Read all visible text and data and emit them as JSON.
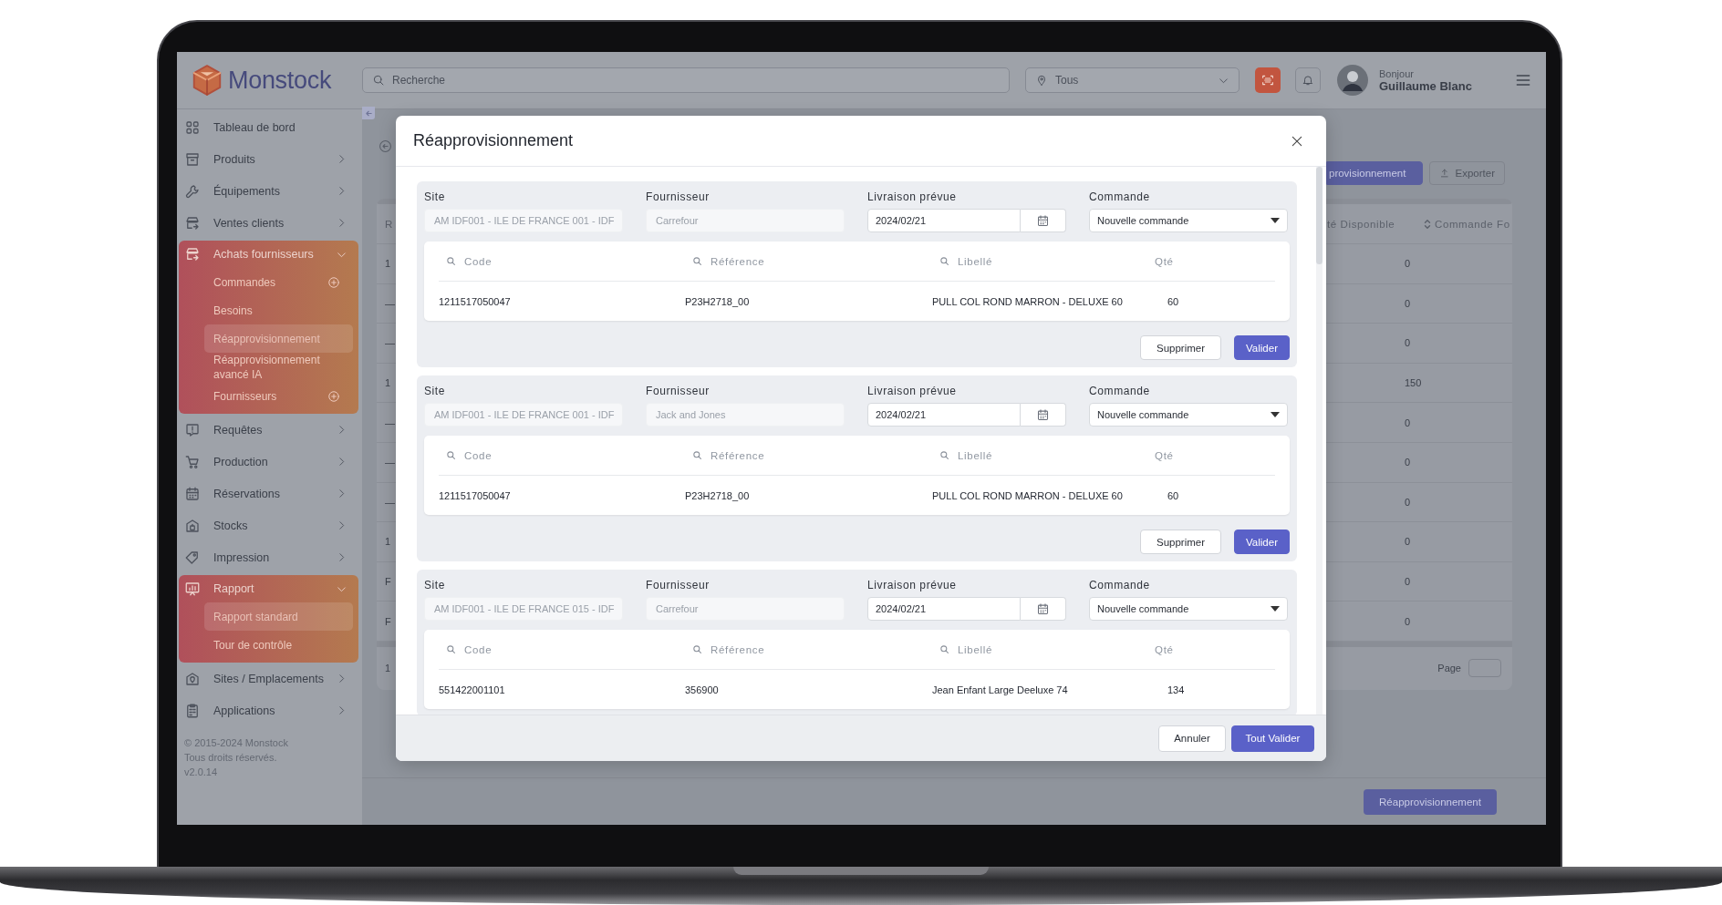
{
  "brand": {
    "name": "Monstock"
  },
  "topbar": {
    "search": {
      "placeholder": "Recherche"
    },
    "site_filter": {
      "value": "Tous"
    },
    "user": {
      "greeting": "Bonjour",
      "name": "Guillaume Blanc"
    }
  },
  "sidebar": {
    "items": [
      {
        "label": "Tableau de bord",
        "kind": "link"
      },
      {
        "label": "Produits",
        "kind": "group",
        "expanded": false
      },
      {
        "label": "Équipements",
        "kind": "group",
        "expanded": false
      },
      {
        "label": "Ventes clients",
        "kind": "group",
        "expanded": false
      },
      {
        "label": "Achats fournisseurs",
        "kind": "group",
        "expanded": true,
        "children": [
          {
            "label": "Commandes",
            "selected": false,
            "addable": true
          },
          {
            "label": "Besoins",
            "selected": false,
            "addable": false
          },
          {
            "label": "Réapprovisionnement",
            "selected": true,
            "addable": false
          },
          {
            "label": "Réapprovisionnement avancé IA",
            "selected": false,
            "addable": false
          },
          {
            "label": "Fournisseurs",
            "selected": false,
            "addable": true
          }
        ]
      },
      {
        "label": "Requêtes",
        "kind": "group",
        "expanded": false
      },
      {
        "label": "Production",
        "kind": "group",
        "expanded": false
      },
      {
        "label": "Réservations",
        "kind": "group",
        "expanded": false
      },
      {
        "label": "Stocks",
        "kind": "group",
        "expanded": false
      },
      {
        "label": "Impression",
        "kind": "group",
        "expanded": false
      },
      {
        "label": "Rapport",
        "kind": "group",
        "expanded": true,
        "children": [
          {
            "label": "Rapport standard",
            "selected": true,
            "addable": false
          },
          {
            "label": "Tour de contrôle",
            "selected": false,
            "addable": false
          }
        ]
      },
      {
        "label": "Sites / Emplacements",
        "kind": "group",
        "expanded": false
      },
      {
        "label": "Applications",
        "kind": "group",
        "expanded": false
      }
    ],
    "footer": [
      "© 2015-2024 Monstock",
      "Tous droits réservés.",
      "v2.0.14"
    ]
  },
  "page": {
    "toolbar": {
      "buttons": [
        {
          "label": "provisionnement",
          "kind": "primary"
        },
        {
          "label": "Exporter",
          "kind": "secondary"
        }
      ]
    },
    "table": {
      "columns": [
        {
          "label": "R",
          "sortable": false
        },
        {
          "label": "té Disponible",
          "sortable": false
        },
        {
          "label": "Commande Fo",
          "sortable": true
        }
      ],
      "rows": [
        [
          "1",
          "0"
        ],
        [
          "—",
          "0"
        ],
        [
          "—",
          "0"
        ],
        [
          "1",
          "150"
        ],
        [
          "—",
          "0"
        ],
        [
          "—",
          "0"
        ],
        [
          "—",
          "0"
        ],
        [
          "1",
          "0"
        ],
        [
          "F",
          "0"
        ],
        [
          "F",
          "0"
        ]
      ],
      "pager": {
        "range": "1",
        "label": "Page"
      }
    },
    "action_button": "Réapprovisionnement"
  },
  "modal": {
    "title": "Réapprovisionnement",
    "sections": [
      {
        "fields": [
          {
            "label": "Site",
            "value": "AM IDF001 - ILE DE FRANCE 001 - IDF",
            "kind": "readonly"
          },
          {
            "label": "Fournisseur",
            "value": "Carrefour",
            "kind": "readonly"
          },
          {
            "label": "Livraison prévue",
            "value": "2024/02/21",
            "kind": "date"
          },
          {
            "label": "Commande",
            "value": "Nouvelle commande",
            "kind": "select"
          }
        ],
        "columns": [
          {
            "label": "Code",
            "searchable": true
          },
          {
            "label": "Référence",
            "searchable": true
          },
          {
            "label": "Libellé",
            "searchable": true
          },
          {
            "label": "Qté",
            "searchable": false
          }
        ],
        "rows": [
          [
            "1211517050047",
            "P23H2718_00",
            "PULL COL ROND MARRON - DELUXE 60",
            "60"
          ]
        ],
        "buttons": [
          {
            "label": "Supprimer",
            "kind": "secondary"
          },
          {
            "label": "Valider",
            "kind": "primary"
          }
        ]
      },
      {
        "fields": [
          {
            "label": "Site",
            "value": "AM IDF001 - ILE DE FRANCE 001 - IDF",
            "kind": "readonly"
          },
          {
            "label": "Fournisseur",
            "value": "Jack and Jones",
            "kind": "readonly"
          },
          {
            "label": "Livraison prévue",
            "value": "2024/02/21",
            "kind": "date"
          },
          {
            "label": "Commande",
            "value": "Nouvelle commande",
            "kind": "select"
          }
        ],
        "columns": [
          {
            "label": "Code",
            "searchable": true
          },
          {
            "label": "Référence",
            "searchable": true
          },
          {
            "label": "Libellé",
            "searchable": true
          },
          {
            "label": "Qté",
            "searchable": false
          }
        ],
        "rows": [
          [
            "1211517050047",
            "P23H2718_00",
            "PULL COL ROND MARRON - DELUXE 60",
            "60"
          ]
        ],
        "buttons": [
          {
            "label": "Supprimer",
            "kind": "secondary"
          },
          {
            "label": "Valider",
            "kind": "primary"
          }
        ]
      },
      {
        "fields": [
          {
            "label": "Site",
            "value": "AM IDF001 - ILE DE FRANCE 015 - IDF",
            "kind": "readonly"
          },
          {
            "label": "Fournisseur",
            "value": "Carrefour",
            "kind": "readonly"
          },
          {
            "label": "Livraison prévue",
            "value": "2024/02/21",
            "kind": "date"
          },
          {
            "label": "Commande",
            "value": "Nouvelle commande",
            "kind": "select"
          }
        ],
        "columns": [
          {
            "label": "Code",
            "searchable": true
          },
          {
            "label": "Référence",
            "searchable": true
          },
          {
            "label": "Libellé",
            "searchable": true
          },
          {
            "label": "Qté",
            "searchable": false
          }
        ],
        "rows": [
          [
            "551422001101",
            "356900",
            "Jean Enfant Large Deeluxe 74",
            "134"
          ]
        ]
      }
    ],
    "buttons": [
      {
        "label": "Annuler",
        "kind": "secondary"
      },
      {
        "label": "Tout Valider",
        "kind": "primary"
      }
    ]
  }
}
